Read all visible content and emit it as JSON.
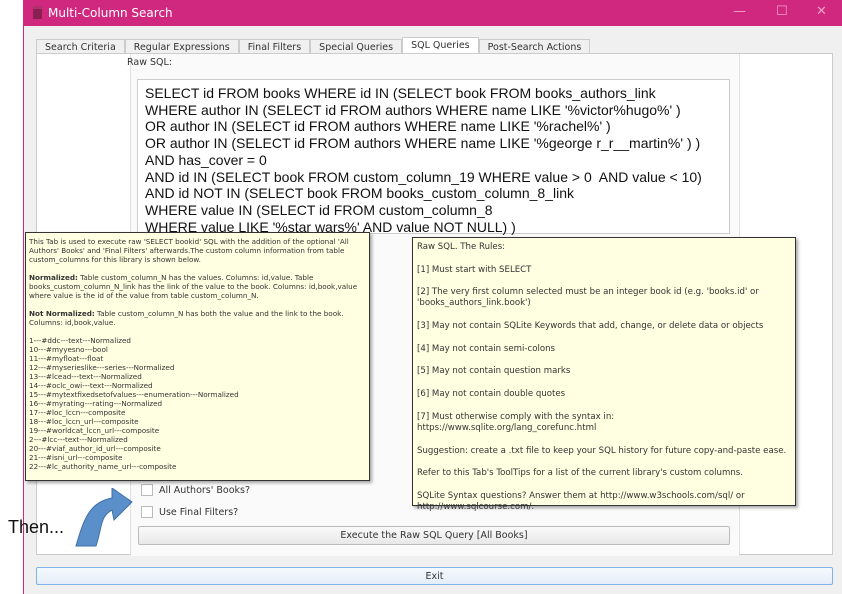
{
  "window": {
    "title": "Multi-Column Search",
    "minimize": "—",
    "maximize": "☐",
    "close": "✕"
  },
  "tabs": [
    "Search Criteria",
    "Regular Expressions",
    "Final Filters",
    "Special Queries",
    "SQL Queries",
    "Post-Search Actions"
  ],
  "raw_sql_label": "Raw SQL:",
  "sql_lines": [
    "SELECT id FROM books WHERE id IN (SELECT book FROM books_authors_link",
    "WHERE author IN (SELECT id FROM authors WHERE name LIKE '%victor%hugo%' )",
    "OR author IN (SELECT id FROM authors WHERE name LIKE '%rachel%' )",
    "OR author IN (SELECT id FROM authors WHERE name LIKE '%george r_r__martin%' ) )",
    "AND has_cover = 0",
    "AND id IN (SELECT book FROM custom_column_19 WHERE value > 0  AND value < 10)",
    "AND id NOT IN (SELECT book FROM books_custom_column_8_link",
    "WHERE value IN (SELECT id FROM custom_column_8",
    "WHERE value LIKE '%star wars%' AND value NOT NULL) )"
  ],
  "checkboxes": {
    "all_authors": "All Authors' Books?",
    "final_filters": "Use Final Filters?"
  },
  "execute_button": "Execute the Raw SQL Query [All Books]",
  "exit_button": "Exit",
  "annotation": "Then...",
  "left_tooltip": {
    "intro": "This Tab is used to execute raw 'SELECT bookid' SQL with the addition of the optional 'All Authors' Books' and 'Final Filters' afterwards.The custom column information from table custom_columns for this library is shown below.",
    "normalized_label": "Normalized:",
    "normalized_text": " Table custom_column_N has the values. Columns: id,value. Table books_custom_column_N_link has the link of the value to the book. Columns: id,book,value where value is the id of the value from table custom_column_N.",
    "not_normalized_label": "Not Normalized:",
    "not_normalized_text": " Table custom_column_N has both the value and the link to the book. Columns: id,book,value.",
    "columns": [
      "1---#ddc---text---Normalized",
      "10---#myyesno---bool",
      "11---#myfloat---float",
      "12---#myserieslike---series---Normalized",
      "13---#lcead---text---Normalized",
      "14---#oclc_owi---text---Normalized",
      "15---#mytextfixedsetofvalues---enumeration---Normalized",
      "16---#myrating---rating---Normalized",
      "17---#loc_lccn---composite",
      "18---#loc_lccn_url---composite",
      "19---#worldcat_lccn_url---composite",
      "2---#lcc---text---Normalized",
      "20---#viaf_author_id_url---composite",
      "21---#isni_url---composite",
      "22---#lc_authority_name_url---composite"
    ]
  },
  "right_tooltip": [
    "Raw SQL. The Rules:",
    "[1] Must start with SELECT",
    "[2] The very first column selected must be an integer book id (e.g. 'books.id' or 'books_authors_link.book')",
    "[3] May not contain SQLite Keywords that add, change, or delete data or objects",
    "[4] May not contain semi-colons",
    "[5] May not contain question marks",
    "[6] May not contain double quotes",
    "[7] Must otherwise comply with the syntax in: https://www.sqlite.org/lang_corefunc.html",
    "Suggestion: create a .txt file to keep your SQL history for future copy-and-paste ease.",
    "Refer to this Tab's ToolTips for a list of the current library's custom columns.",
    "SQLite Syntax questions? Answer them at http://www.w3schools.com/sql/ or http://www.sqlcourse.com/."
  ]
}
